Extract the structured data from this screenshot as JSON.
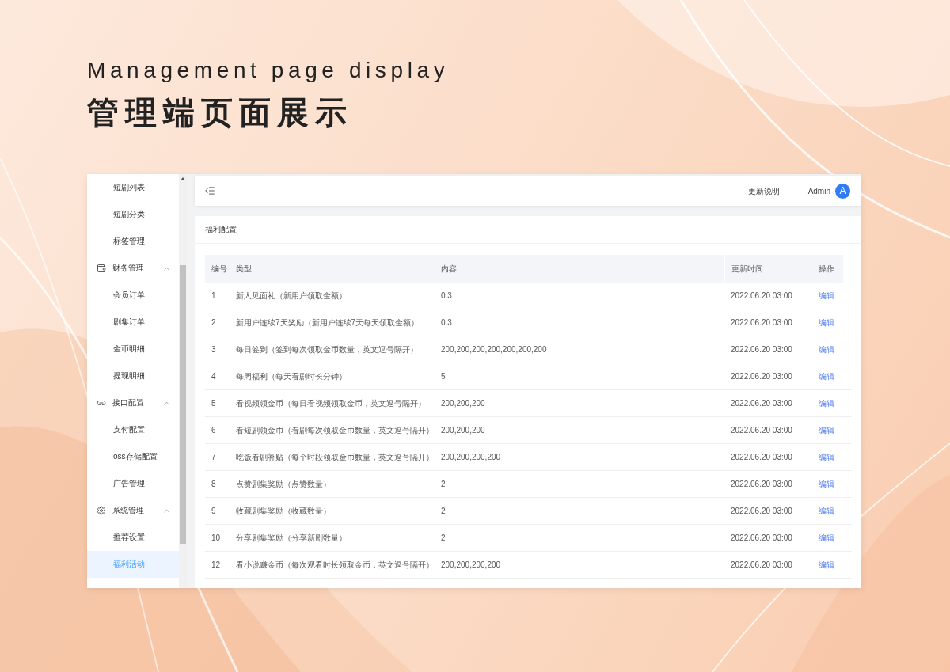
{
  "title_en": "Management page display",
  "title_zh": "管理端页面展示",
  "sidebar": {
    "items": [
      {
        "kind": "item",
        "label": "短剧列表",
        "selected": false
      },
      {
        "kind": "item",
        "label": "短剧分类",
        "selected": false
      },
      {
        "kind": "item",
        "label": "标签管理",
        "selected": false
      },
      {
        "kind": "group",
        "label": "财务管理",
        "expanded": true,
        "children": [
          {
            "kind": "item",
            "label": "会员订单",
            "selected": false
          },
          {
            "kind": "item",
            "label": "剧集订单",
            "selected": false
          },
          {
            "kind": "item",
            "label": "金币明细",
            "selected": false
          },
          {
            "kind": "item",
            "label": "提现明细",
            "selected": false
          }
        ]
      },
      {
        "kind": "group",
        "label": "接口配置",
        "expanded": true,
        "children": [
          {
            "kind": "item",
            "label": "支付配置",
            "selected": false
          },
          {
            "kind": "item",
            "label": "oss存储配置",
            "selected": false
          },
          {
            "kind": "item",
            "label": "广告管理",
            "selected": false
          }
        ]
      },
      {
        "kind": "group",
        "label": "系统管理",
        "expanded": true,
        "children": [
          {
            "kind": "item",
            "label": "推荐设置",
            "selected": false
          },
          {
            "kind": "item",
            "label": "福利活动",
            "selected": true
          }
        ]
      }
    ]
  },
  "header": {
    "links": [
      "更新说明"
    ],
    "user": {
      "name": "Admin",
      "avatar": "A"
    }
  },
  "card": {
    "title": "福利配置"
  },
  "table": {
    "columns": [
      "编号",
      "类型",
      "内容",
      "更新时间",
      "操作"
    ],
    "rows": [
      {
        "cells": [
          "1",
          "新人见面礼（新用户领取金额）",
          "0.3",
          "2022.06.20 03:00"
        ],
        "action": "编辑"
      },
      {
        "cells": [
          "2",
          "新用户连续7天奖励（新用户连续7天每天领取金额）",
          "0.3",
          "2022.06.20 03:00"
        ],
        "action": "编辑"
      },
      {
        "cells": [
          "3",
          "每日签到（签到每次领取金币数量，英文逗号隔开）",
          "200,200,200,200,200,200,200",
          "2022.06.20 03:00"
        ],
        "action": "编辑"
      },
      {
        "cells": [
          "4",
          "每周福利（每天看剧时长分钟）",
          "5",
          "2022.06.20 03:00"
        ],
        "action": "编辑"
      },
      {
        "cells": [
          "5",
          "看视频领金币（每日看视频领取金币，英文逗号隔开）",
          "200,200,200",
          "2022.06.20 03:00"
        ],
        "action": "编辑"
      },
      {
        "cells": [
          "6",
          "看短剧领金币（看剧每次领取金币数量，英文逗号隔开）",
          "200,200,200",
          "2022.06.20 03:00"
        ],
        "action": "编辑"
      },
      {
        "cells": [
          "7",
          "吃饭看剧补贴（每个时段领取金币数量，英文逗号隔开）",
          "200,200,200,200",
          "2022.06.20 03:00"
        ],
        "action": "编辑"
      },
      {
        "cells": [
          "8",
          "点赞剧集奖励（点赞数量）",
          "2",
          "2022.06.20 03:00"
        ],
        "action": "编辑"
      },
      {
        "cells": [
          "9",
          "收藏剧集奖励（收藏数量）",
          "2",
          "2022.06.20 03:00"
        ],
        "action": "编辑"
      },
      {
        "cells": [
          "10",
          "分享剧集奖励（分享新剧数量）",
          "2",
          "2022.06.20 03:00"
        ],
        "action": "编辑"
      },
      {
        "cells": [
          "12",
          "看小说赚金币（每次观看时长领取金币，英文逗号隔开）",
          "200,200,200,200",
          "2022.06.20 03:00"
        ],
        "action": "编辑"
      }
    ]
  }
}
